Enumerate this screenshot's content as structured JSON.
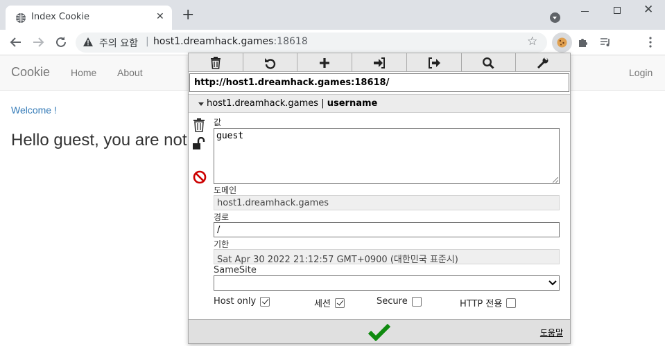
{
  "tab": {
    "title": "Index Cookie",
    "close": "✕",
    "new": "+"
  },
  "window": {
    "close": "✕"
  },
  "omnibox": {
    "warning": "주의 요함",
    "separator": "|",
    "host": "host1.dreamhack.games",
    "port": ":18618"
  },
  "site": {
    "brand": "Cookie",
    "nav": [
      "Home",
      "About"
    ],
    "login": "Login",
    "welcome": "Welcome !",
    "hello": "Hello guest, you are not"
  },
  "popup": {
    "url": "http://host1.dreamhack.games:18618/",
    "cookie_domain": "host1.dreamhack.games",
    "cookie_sep": "|",
    "cookie_name": "username",
    "labels": {
      "value": "값",
      "domain": "도메인",
      "path": "경로",
      "expiry": "기한",
      "samesite": "SameSite"
    },
    "fields": {
      "value": "guest",
      "domain": "host1.dreamhack.games",
      "path": "/",
      "expiry": "Sat Apr 30 2022 21:12:57 GMT+0900 (대한민국 표준시)",
      "samesite": ""
    },
    "checkboxes": [
      {
        "label": "Host only",
        "checked": true
      },
      {
        "label": "세션",
        "checked": true
      },
      {
        "label": "Secure",
        "checked": false
      },
      {
        "label": "HTTP 전용",
        "checked": false
      }
    ],
    "help": "도움말"
  },
  "colors": {
    "accent_link": "#337ab7",
    "confirm_green": "#0f8a0f",
    "block_red": "#cc0000"
  }
}
